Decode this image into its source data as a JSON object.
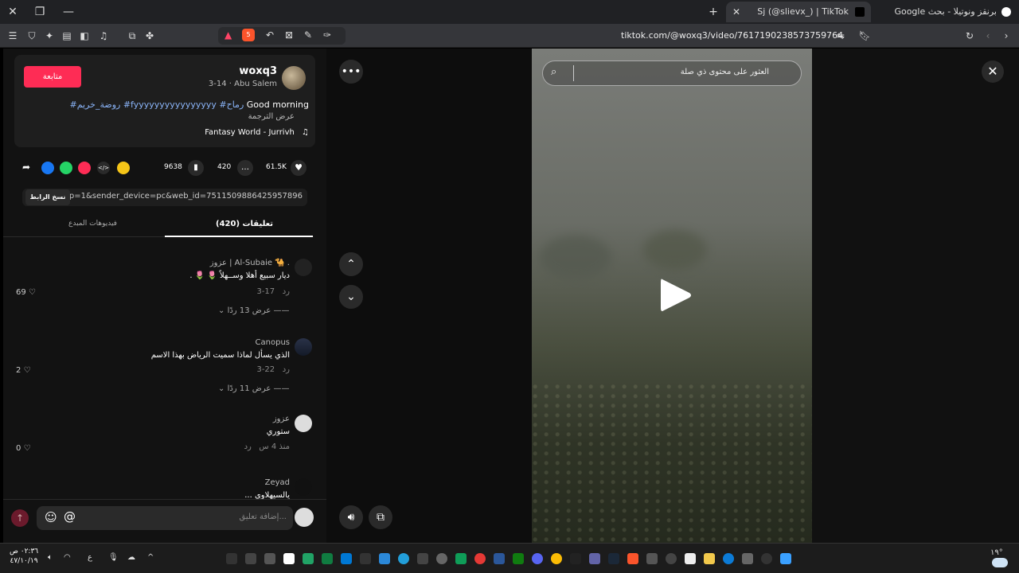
{
  "browser": {
    "tab_active_title": "Sj (@slievx_) | TikTok",
    "tab_inactive_title": "برنقز ونوتيلا - بحث Google",
    "url": "tiktok.com/@woxq3/video/7617190238573759764",
    "brave_badge": "5"
  },
  "post": {
    "username": "woxq3",
    "subtitle": "3-14 · Abu Salem",
    "follow_label": "متابعة",
    "caption_plain": "Good morning",
    "caption_tags": "#روضة_خريم #fyyyyyyyyyyyyyyyy #رماح",
    "translate_label": "عرض الترجمة",
    "music": "Fantasy World - Jurrivh"
  },
  "actions": {
    "likes": "61.5K",
    "comments": "420",
    "saves": "9638"
  },
  "share_link": {
    "text": "...p=1&sender_device=pc&web_id=7511509886425957896",
    "copy_label": "نسخ الرابط"
  },
  "tabs": {
    "comments": "(420) تعليقات",
    "creator_videos": "فيديوهات المبدع"
  },
  "comments": [
    {
      "user": "عزوز | Al-Subaie 🐪 .",
      "text": "ديار سبيع أهلا وســهلاً 🌷 🌷 .",
      "date": "3-17",
      "reply": "رد",
      "likes": "69",
      "replies": "عرض 13 ردًا"
    },
    {
      "user": "Canopus",
      "text": "الذي يسأل لماذا سميت الرياض بهذا الاسم",
      "date": "3-22",
      "reply": "رد",
      "likes": "2",
      "replies": "عرض 11 ردًا"
    },
    {
      "user": "عزوز",
      "text": "ستوري",
      "date": "منذ 4 س",
      "reply": "رد",
      "likes": "0"
    },
    {
      "user": "Zeyad",
      "text": "يالسيهلاوي ..."
    }
  ],
  "comment_bar": {
    "placeholder": "إضافة تعليق..."
  },
  "video": {
    "search_placeholder": "العثور على محتوى ذي صلة"
  },
  "taskbar": {
    "time": "٠٢:٣٦ ص",
    "date": "٤٧/١٠/١٩",
    "weather": "١٩°",
    "lang": "ع"
  }
}
